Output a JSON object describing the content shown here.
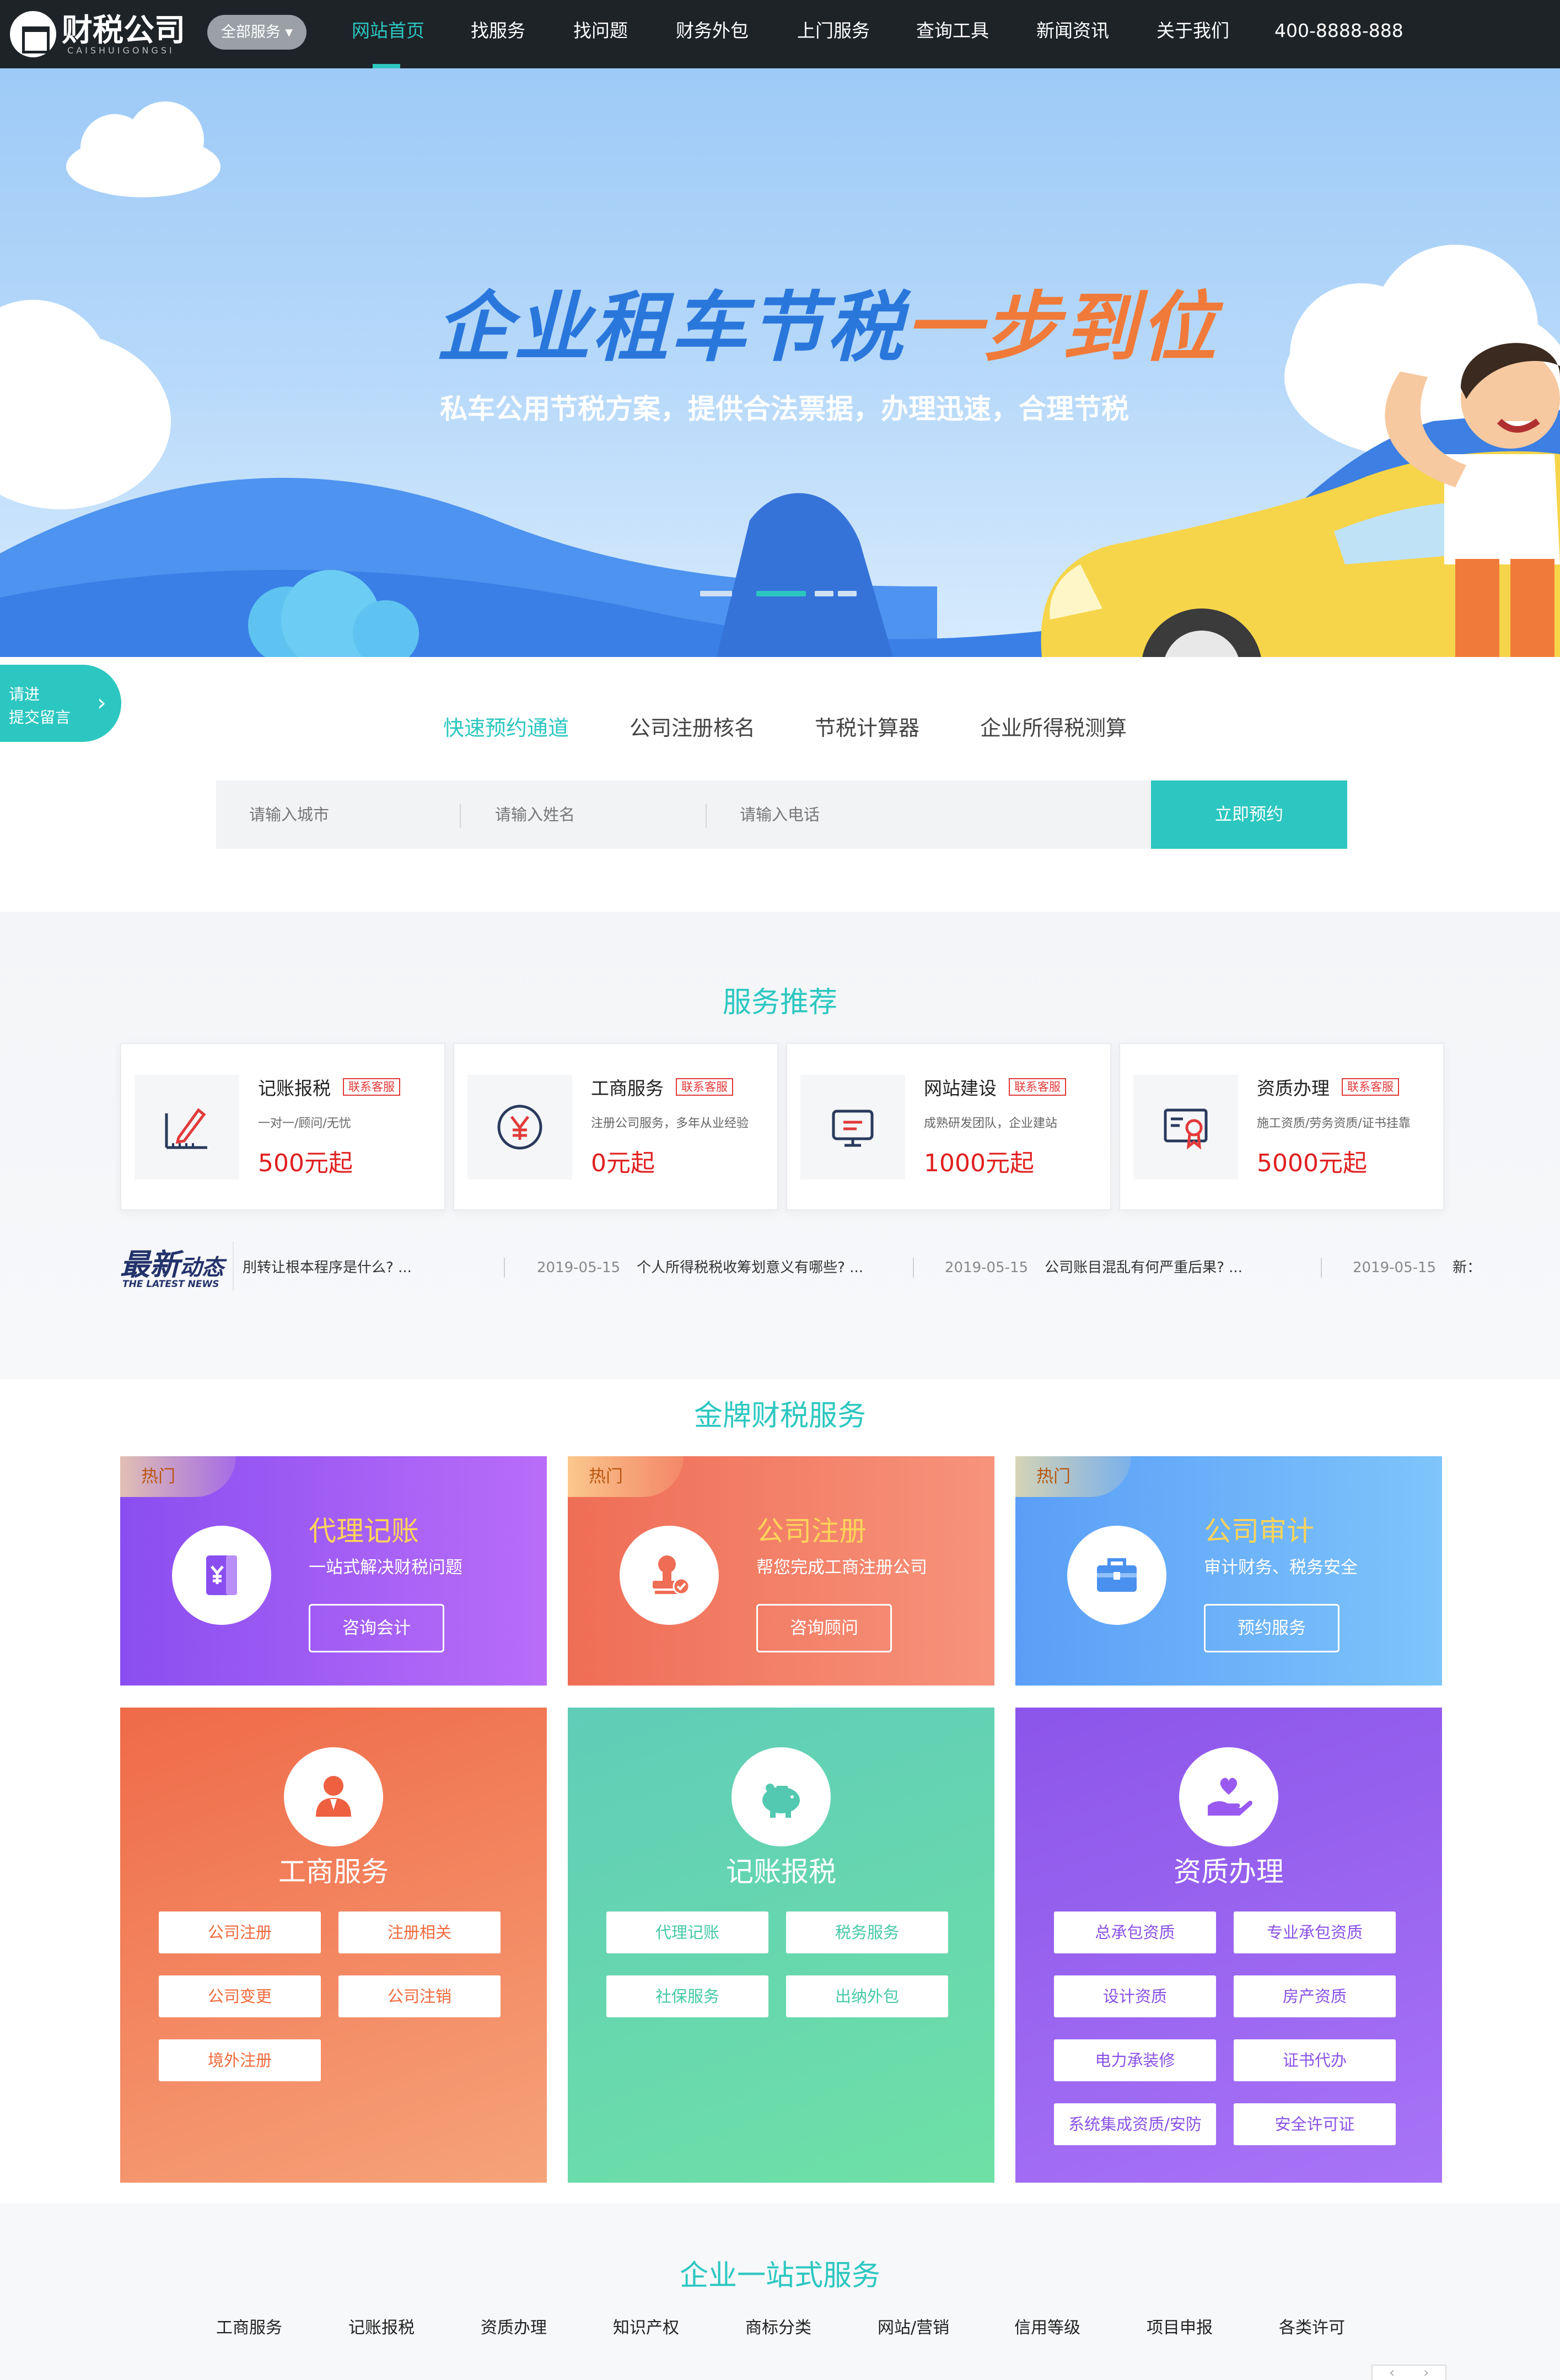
{
  "nav": {
    "logo_title": "财税公司",
    "logo_sub": "CAISHUIGONGSI",
    "all_services": "全部服务 ▾",
    "items": [
      "网站首页",
      "找服务",
      "找问题",
      "财务外包",
      "上门服务",
      "查询工具",
      "新闻资讯",
      "关于我们"
    ],
    "phone": "400-8888-888",
    "active": "网站首页"
  },
  "banner": {
    "title_main": "企业租车节税",
    "title_em": "一步到位",
    "subtitle": "私车公用节税方案，提供合法票据，办理迅速，合理节税",
    "slide_count": 4,
    "active_slide": 2
  },
  "side_tab": {
    "line1": "请进",
    "line2": "提交留言",
    "arrow": "›"
  },
  "quick": {
    "tabs": [
      "快速预约通道",
      "公司注册核名",
      "节税计算器",
      "企业所得税测算"
    ],
    "active": "快速预约通道",
    "city_placeholder": "请输入城市",
    "name_placeholder": "请输入姓名",
    "phone_placeholder": "请输入电话",
    "submit": "立即预约"
  },
  "services": {
    "title": "服务推荐",
    "cards": [
      {
        "name": "记账报税",
        "tag": "联系客服",
        "desc": "一对一/顾问/无忧",
        "price": "500元起",
        "icon": "ruler-pen-icon"
      },
      {
        "name": "工商服务",
        "tag": "联系客服",
        "desc": "注册公司服务，多年从业经验",
        "price": "0元起",
        "icon": "yen-circle-icon"
      },
      {
        "name": "网站建设",
        "tag": "联系客服",
        "desc": "成熟研发团队，企业建站",
        "price": "1000元起",
        "icon": "monitor-icon"
      },
      {
        "name": "资质办理",
        "tag": "联系客服",
        "desc": "施工资质/劳务资质/证书挂靠",
        "price": "5000元起",
        "icon": "certificate-icon"
      }
    ]
  },
  "news": {
    "logo_main": "最新",
    "logo_suffix": "动态",
    "logo_en": "THE LATEST NEWS",
    "items": [
      {
        "date": "",
        "title": "刖转让根本程序是什么? ..."
      },
      {
        "date": "2019-05-15",
        "title": "个人所得税税收筹划意义有哪些? ..."
      },
      {
        "date": "2019-05-15",
        "title": "公司账目混乱有何严重后果? ..."
      },
      {
        "date": "2019-05-15",
        "title": "新："
      }
    ]
  },
  "gold": {
    "title": "金牌财税服务",
    "hot_label": "热门",
    "cards": [
      {
        "title": "代理记账",
        "desc": "一站式解决财税问题",
        "button": "咨询会计",
        "icon": "ledger-book-icon"
      },
      {
        "title": "公司注册",
        "desc": "帮您完成工商注册公司",
        "button": "咨询顾问",
        "icon": "stamp-check-icon"
      },
      {
        "title": "公司审计",
        "desc": "审计财务、税务安全",
        "button": "预约服务",
        "icon": "briefcase-icon"
      }
    ]
  },
  "biz": {
    "cards": [
      {
        "title": "工商服务",
        "icon": "business-person-icon",
        "chips": [
          "公司注册",
          "注册相关",
          "公司变更",
          "公司注销",
          "境外注册"
        ]
      },
      {
        "title": "记账报税",
        "icon": "piggy-bank-icon",
        "chips": [
          "代理记账",
          "税务服务",
          "社保服务",
          "出纳外包"
        ]
      },
      {
        "title": "资质办理",
        "icon": "hand-heart-icon",
        "chips": [
          "总承包资质",
          "专业承包资质",
          "设计资质",
          "房产资质",
          "电力承装修",
          "证书代办",
          "系统集成资质/安防",
          "安全许可证"
        ]
      }
    ]
  },
  "bottom": {
    "title": "企业一站式服务",
    "items": [
      "工商服务",
      "记账报税",
      "资质办理",
      "知识产权",
      "商标分类",
      "网站/营销",
      "信用等级",
      "项目申报",
      "各类许可"
    ],
    "pager_prev": "‹",
    "pager_next": "›"
  },
  "colors": {
    "accent": "#2cc7c0",
    "nav_bg": "#1e2328",
    "price_red": "#e02020",
    "gold_title": "#ffd45a",
    "biz_orange_chip": "#f06a3c",
    "biz_green_chip": "#45c9a8",
    "biz_purple_chip": "#8a52e6"
  }
}
